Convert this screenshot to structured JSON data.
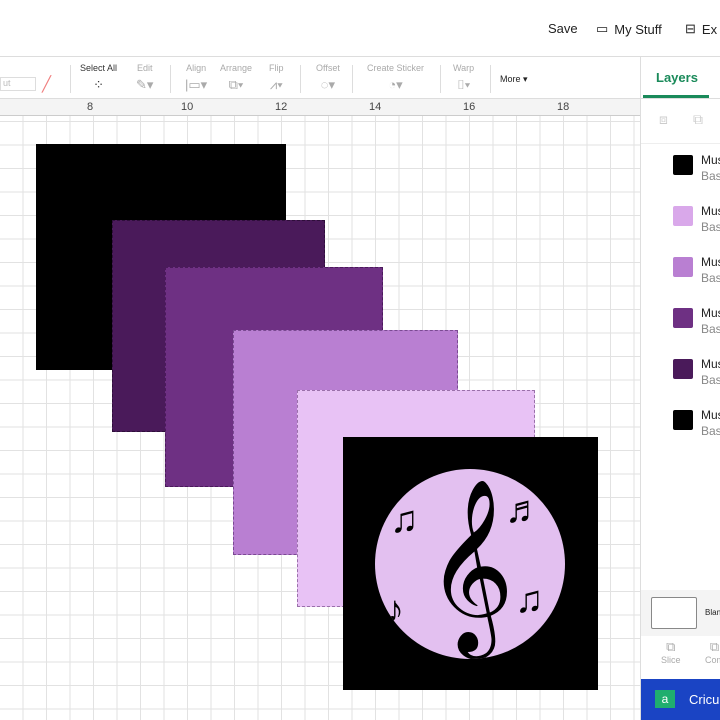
{
  "header": {
    "save": "Save",
    "my_stuff": "My Stuff",
    "extra": "Ex"
  },
  "toolbar": {
    "select_all": "Select All",
    "edit": "Edit",
    "align": "Align",
    "arrange": "Arrange",
    "flip": "Flip",
    "offset": "Offset",
    "create_sticker": "Create Sticker",
    "warp": "Warp",
    "more": "More ▾",
    "linetype_value": "ut"
  },
  "ruler": {
    "ticks": [
      "8",
      "10",
      "12",
      "14",
      "16",
      "18"
    ]
  },
  "panel": {
    "tab": "Layers",
    "layers": [
      {
        "name": "Mus",
        "type": "Bas",
        "color": "#000000"
      },
      {
        "name": "Mus",
        "type": "Bas",
        "color": "#d9a8ea"
      },
      {
        "name": "Mus",
        "type": "Bas",
        "color": "#b97fd2"
      },
      {
        "name": "Mus",
        "type": "Bas",
        "color": "#6e3083"
      },
      {
        "name": "Mus",
        "type": "Bas",
        "color": "#4a1a5a"
      },
      {
        "name": "Mus",
        "type": "Bas",
        "color": "#000000"
      }
    ],
    "blank": "Blan",
    "slice": "Slice",
    "combine": "Com",
    "cricut": "Cricu"
  },
  "canvas": {
    "layer_colors": [
      "#000000",
      "#4a1a5a",
      "#6e3083",
      "#b97fd2",
      "#e8c2f5",
      "#000000"
    ]
  }
}
